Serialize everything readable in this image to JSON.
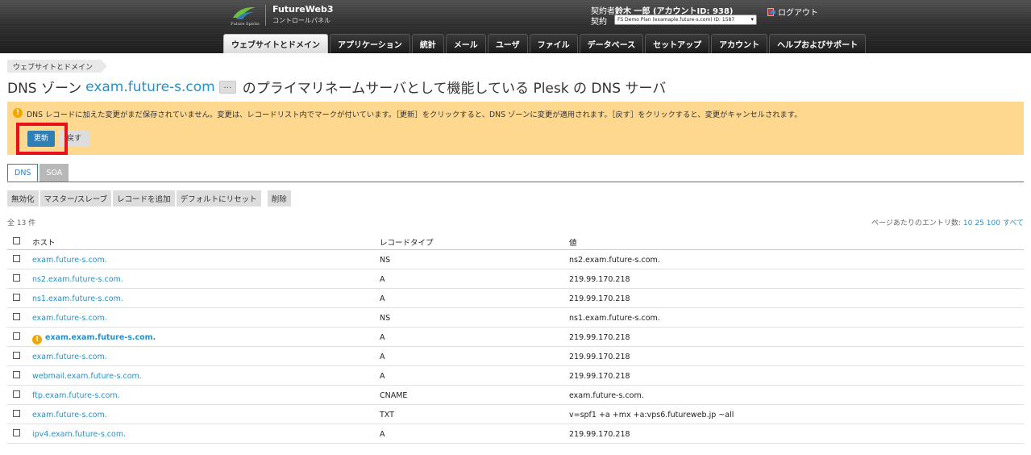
{
  "header": {
    "logo_text": "Future Spirits",
    "brand_title": "FutureWeb3",
    "brand_subtitle": "コントロールパネル",
    "user_prefix": "契約者",
    "user_name": "鈴木 一郎 (アカウントID: 938)",
    "contract_label": "契約",
    "contract_value": "FS Demo Plan (examaple.future-s.com) ID: 1587",
    "logout_label": "ログアウト"
  },
  "nav": {
    "tabs": [
      {
        "label": "ウェブサイトとドメイン",
        "active": true
      },
      {
        "label": "アプリケーション",
        "active": false
      },
      {
        "label": "統計",
        "active": false
      },
      {
        "label": "メール",
        "active": false
      },
      {
        "label": "ユーザ",
        "active": false
      },
      {
        "label": "ファイル",
        "active": false
      },
      {
        "label": "データベース",
        "active": false
      },
      {
        "label": "セットアップ",
        "active": false
      },
      {
        "label": "アカウント",
        "active": false
      },
      {
        "label": "ヘルプおよびサポート",
        "active": false
      }
    ]
  },
  "breadcrumb": "ウェブサイトとドメイン",
  "title": {
    "prefix": "DNS ゾーン",
    "domain": "exam.future-s.com",
    "ellipsis": "…",
    "suffix": "のプライマリネームサーバとして機能している Plesk の DNS サーバ"
  },
  "warning": {
    "icon": "!",
    "text": "DNS レコードに加えた変更がまだ保存されていません。変更は、レコードリスト内でマークが付いています。［更新］をクリックすると、DNS ゾーンに変更が適用されます。［戻す］をクリックすると、変更がキャンセルされます。",
    "update_label": "更新",
    "revert_label": "戻す"
  },
  "tabs": [
    {
      "label": "DNS",
      "active": true
    },
    {
      "label": "SOA",
      "active": false
    }
  ],
  "toolbar": {
    "disable": "無効化",
    "master_slave": "マスター/スレーブ",
    "add_record": "レコードを追加",
    "reset_default": "デフォルトにリセット",
    "delete": "削除"
  },
  "total": "全 13 件",
  "paging": {
    "label": "ページあたりのエントリ数:",
    "options": [
      "10",
      "25",
      "100",
      "すべて"
    ]
  },
  "table": {
    "headers": {
      "host": "ホスト",
      "type": "レコードタイプ",
      "value": "値"
    },
    "rows": [
      {
        "host": "exam.future-s.com.",
        "type": "NS",
        "value": "ns2.exam.future-s.com.",
        "modified": false
      },
      {
        "host": "ns2.exam.future-s.com.",
        "type": "A",
        "value": "219.99.170.218",
        "modified": false
      },
      {
        "host": "ns1.exam.future-s.com.",
        "type": "A",
        "value": "219.99.170.218",
        "modified": false
      },
      {
        "host": "exam.future-s.com.",
        "type": "NS",
        "value": "ns1.exam.future-s.com.",
        "modified": false
      },
      {
        "host": "exam.exam.future-s.com.",
        "type": "A",
        "value": "219.99.170.218",
        "modified": true
      },
      {
        "host": "exam.future-s.com.",
        "type": "A",
        "value": "219.99.170.218",
        "modified": false
      },
      {
        "host": "webmail.exam.future-s.com.",
        "type": "A",
        "value": "219.99.170.218",
        "modified": false
      },
      {
        "host": "ftp.exam.future-s.com.",
        "type": "CNAME",
        "value": "exam.future-s.com.",
        "modified": false
      },
      {
        "host": "exam.future-s.com.",
        "type": "TXT",
        "value": "v=spf1 +a +mx +a:vps6.futureweb.jp ~all",
        "modified": false
      },
      {
        "host": "ipv4.exam.future-s.com.",
        "type": "A",
        "value": "219.99.170.218",
        "modified": false
      }
    ]
  },
  "colors": {
    "accent": "#2e7fb6",
    "link": "#2a8fc4",
    "warning_bg": "#ffd890",
    "highlight": "#e8101a"
  }
}
